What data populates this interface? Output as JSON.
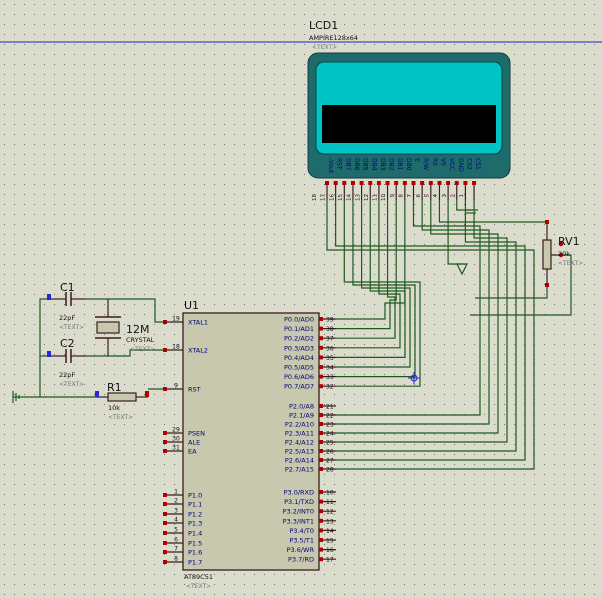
{
  "colors": {
    "background": "#dcdccc",
    "grid_dot": "#6f6f6f",
    "wire": "#1f5a1f",
    "outline": "#3a1d1d",
    "pin": "#b00000",
    "pin_dot_blue": "#2828d0",
    "text": "#111111",
    "text_blue": "#00007a",
    "chip_fill": "#c7c8ad",
    "lcd_frame": "#1f6b6b",
    "lcd_screen": "#00c4c4",
    "border_line": "#3c4cc8"
  },
  "lcd": {
    "ref": "LCD1",
    "model": "AMPIRE128x64",
    "text_tag": "<TEXT>",
    "pins": [
      {
        "label": "-Vout",
        "num": "18"
      },
      {
        "label": "RST",
        "num": "17"
      },
      {
        "label": "DB7",
        "num": "16"
      },
      {
        "label": "DB6",
        "num": "15"
      },
      {
        "label": "DB5",
        "num": "14"
      },
      {
        "label": "DB4",
        "num": "13"
      },
      {
        "label": "DB3",
        "num": "12"
      },
      {
        "label": "DB2",
        "num": "11"
      },
      {
        "label": "DB1",
        "num": "10"
      },
      {
        "label": "DB0",
        "num": "9"
      },
      {
        "label": "E",
        "num": "8"
      },
      {
        "label": "R/W",
        "num": "7"
      },
      {
        "label": "RS",
        "num": "6"
      },
      {
        "label": "V0",
        "num": "5"
      },
      {
        "label": "VCC",
        "num": "4"
      },
      {
        "label": "GND",
        "num": "3"
      },
      {
        "label": "CS2",
        "num": "2"
      },
      {
        "label": "CS1",
        "num": "1"
      }
    ]
  },
  "rv1": {
    "ref": "RV1",
    "value": "20k",
    "text_tag": "<TEXT>"
  },
  "c1": {
    "ref": "C1",
    "value": "22pF",
    "text_tag": "<TEXT>"
  },
  "c2": {
    "ref": "C2",
    "value": "22pF",
    "text_tag": "<TEXT>"
  },
  "x1": {
    "ref": "12M",
    "value": "CRYSTAL",
    "text_tag": "<TEXT>"
  },
  "r1": {
    "ref": "R1",
    "value": "10k",
    "text_tag": "<TEXT>"
  },
  "u1": {
    "ref": "U1",
    "part": "AT89C51",
    "text_tag": "<TEXT>",
    "left_pins": [
      {
        "label": "XTAL1",
        "num": "19"
      },
      {
        "label": "XTAL2",
        "num": "18"
      },
      {
        "label": "RST",
        "num": "9"
      },
      {
        "label": "PSEN",
        "num": "29"
      },
      {
        "label": "ALE",
        "num": "30"
      },
      {
        "label": "EA",
        "num": "31"
      },
      {
        "label": "P1.0",
        "num": "1"
      },
      {
        "label": "P1.1",
        "num": "2"
      },
      {
        "label": "P1.2",
        "num": "3"
      },
      {
        "label": "P1.3",
        "num": "4"
      },
      {
        "label": "P1.4",
        "num": "5"
      },
      {
        "label": "P1.5",
        "num": "6"
      },
      {
        "label": "P1.6",
        "num": "7"
      },
      {
        "label": "P1.7",
        "num": "8"
      }
    ],
    "right_pins": [
      {
        "label": "P0.0/AD0",
        "num": "39"
      },
      {
        "label": "P0.1/AD1",
        "num": "38"
      },
      {
        "label": "P0.2/AD2",
        "num": "37"
      },
      {
        "label": "P0.3/AD3",
        "num": "36"
      },
      {
        "label": "P0.4/AD4",
        "num": "35"
      },
      {
        "label": "P0.5/AD5",
        "num": "34"
      },
      {
        "label": "P0.6/AD6",
        "num": "33"
      },
      {
        "label": "P0.7/AD7",
        "num": "32"
      },
      {
        "label": "P2.0/A8",
        "num": "21"
      },
      {
        "label": "P2.1/A9",
        "num": "22"
      },
      {
        "label": "P2.2/A10",
        "num": "23"
      },
      {
        "label": "P2.3/A11",
        "num": "24"
      },
      {
        "label": "P2.4/A12",
        "num": "25"
      },
      {
        "label": "P2.5/A13",
        "num": "26"
      },
      {
        "label": "P2.6/A14",
        "num": "27"
      },
      {
        "label": "P2.7/A15",
        "num": "28"
      },
      {
        "label": "P3.0/RXD",
        "num": "10"
      },
      {
        "label": "P3.1/TXD",
        "num": "11"
      },
      {
        "label": "P3.2/INT0",
        "num": "12"
      },
      {
        "label": "P3.3/INT1",
        "num": "13"
      },
      {
        "label": "P3.4/T0",
        "num": "14"
      },
      {
        "label": "P3.5/T1",
        "num": "15"
      },
      {
        "label": "P3.6/WR",
        "num": "16"
      },
      {
        "label": "P3.7/RD",
        "num": "17"
      }
    ]
  }
}
